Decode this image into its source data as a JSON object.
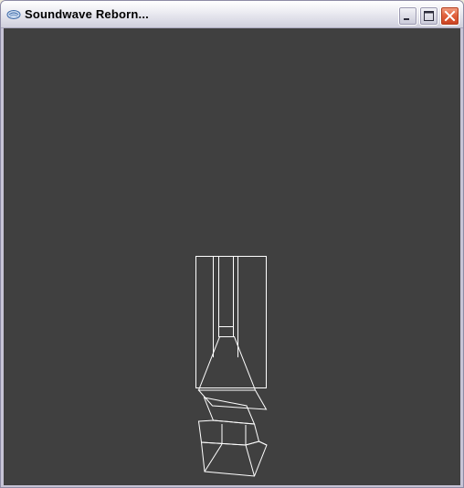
{
  "window": {
    "title": "Soundwave Reborn...",
    "icon": "app-icon"
  },
  "controls": {
    "minimize_icon": "minimize-icon",
    "maximize_icon": "maximize-icon",
    "close_icon": "close-icon"
  },
  "viewport": {
    "background_color": "#404040",
    "wireframe_color": "#ffffff",
    "content": "wireframe-model"
  }
}
